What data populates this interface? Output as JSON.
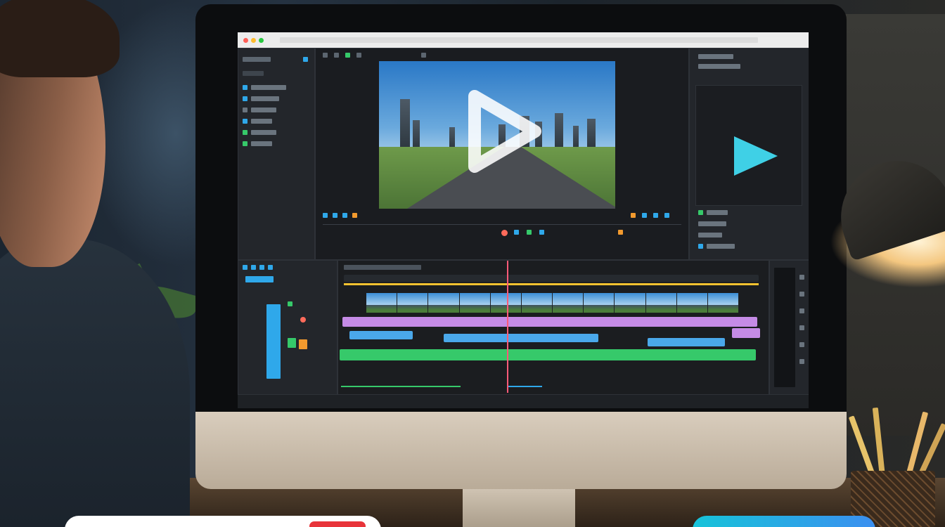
{
  "app": {
    "name": "video-editor",
    "accent_blue": "#2fa8ea",
    "accent_green": "#36c96a",
    "accent_orange": "#f29a2e",
    "accent_purple": "#c58be6",
    "playhead_color": "#ff5a78",
    "play_icon_color": "#3fd0e6"
  },
  "preview": {
    "subject": "city-highway-skyline",
    "overlay_icon": "play-icon"
  },
  "inspector": {
    "preview_icon": "play-icon"
  },
  "timeline": {
    "tracks": [
      "video-thumbnails",
      "purple-track",
      "blue-track",
      "green-track"
    ]
  },
  "bottom_cards": {
    "left_accent": "#e8343a",
    "right_gradient": [
      "#17c3d9",
      "#3b8ff0"
    ]
  }
}
